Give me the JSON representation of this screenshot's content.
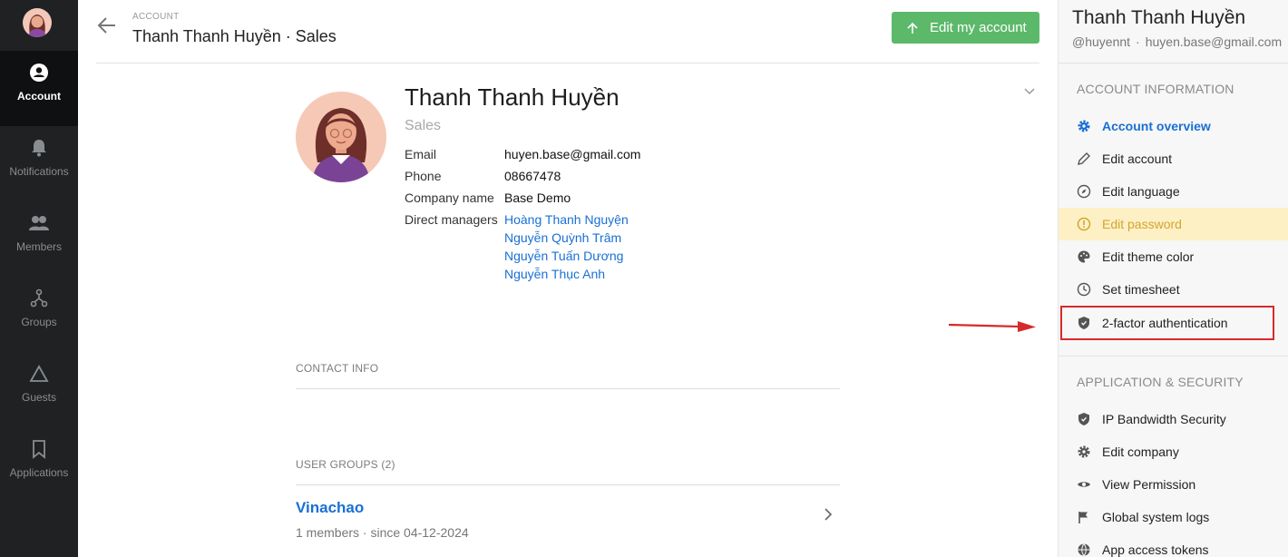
{
  "nav": {
    "items": [
      {
        "label": "Account",
        "icon": "account-icon"
      },
      {
        "label": "Notifications",
        "icon": "bell-icon"
      },
      {
        "label": "Members",
        "icon": "members-icon"
      },
      {
        "label": "Groups",
        "icon": "groups-icon"
      },
      {
        "label": "Guests",
        "icon": "triangle-icon"
      },
      {
        "label": "Applications",
        "icon": "bookmark-icon"
      }
    ]
  },
  "header": {
    "crumb": "ACCOUNT",
    "title": "Thanh Thanh Huyền · Sales",
    "edit_button": "Edit my account"
  },
  "profile": {
    "name": "Thanh Thanh Huyền",
    "role": "Sales",
    "fields": [
      {
        "label": "Email",
        "value": "huyen.base@gmail.com"
      },
      {
        "label": "Phone",
        "value": "08667478"
      },
      {
        "label": "Company name",
        "value": "Base Demo"
      }
    ],
    "managers_label": "Direct managers",
    "managers": [
      "Hoàng Thanh Nguyện",
      "Nguyễn Quỳnh Trâm",
      "Nguyễn Tuấn Dương",
      "Nguyễn Thục Anh"
    ]
  },
  "sections": {
    "contact": "CONTACT INFO",
    "groups": "USER GROUPS (2)"
  },
  "groups": [
    {
      "name": "Vinachao",
      "meta": "1 members · since 04-12-2024"
    }
  ],
  "right_panel": {
    "name": "Thanh Thanh Huyền",
    "handle": "@huyennt",
    "separator": "·",
    "email": "huyen.base@gmail.com",
    "account_section": "ACCOUNT INFORMATION",
    "account_items": [
      {
        "label": "Account overview",
        "icon": "gear-icon"
      },
      {
        "label": "Edit account",
        "icon": "pencil-icon"
      },
      {
        "label": "Edit language",
        "icon": "compass-icon"
      },
      {
        "label": "Edit password",
        "icon": "alert-circle-icon"
      },
      {
        "label": "Edit theme color",
        "icon": "palette-icon"
      },
      {
        "label": "Set timesheet",
        "icon": "clock-icon"
      },
      {
        "label": "2-factor authentication",
        "icon": "shield-icon"
      }
    ],
    "security_section": "APPLICATION & SECURITY",
    "security_items": [
      {
        "label": "IP Bandwidth Security",
        "icon": "shield-icon"
      },
      {
        "label": "Edit company",
        "icon": "gear-icon"
      },
      {
        "label": "View Permission",
        "icon": "eye-icon"
      },
      {
        "label": "Global system logs",
        "icon": "flag-icon"
      },
      {
        "label": "App access tokens",
        "icon": "globe-icon"
      }
    ]
  },
  "colors": {
    "nav_bg": "#1f2123",
    "accent_blue": "#1a6fd4",
    "edit_button_green": "#5cb96a",
    "warning_bg": "#fdf0c4",
    "highlight_red": "#d62b2b"
  }
}
